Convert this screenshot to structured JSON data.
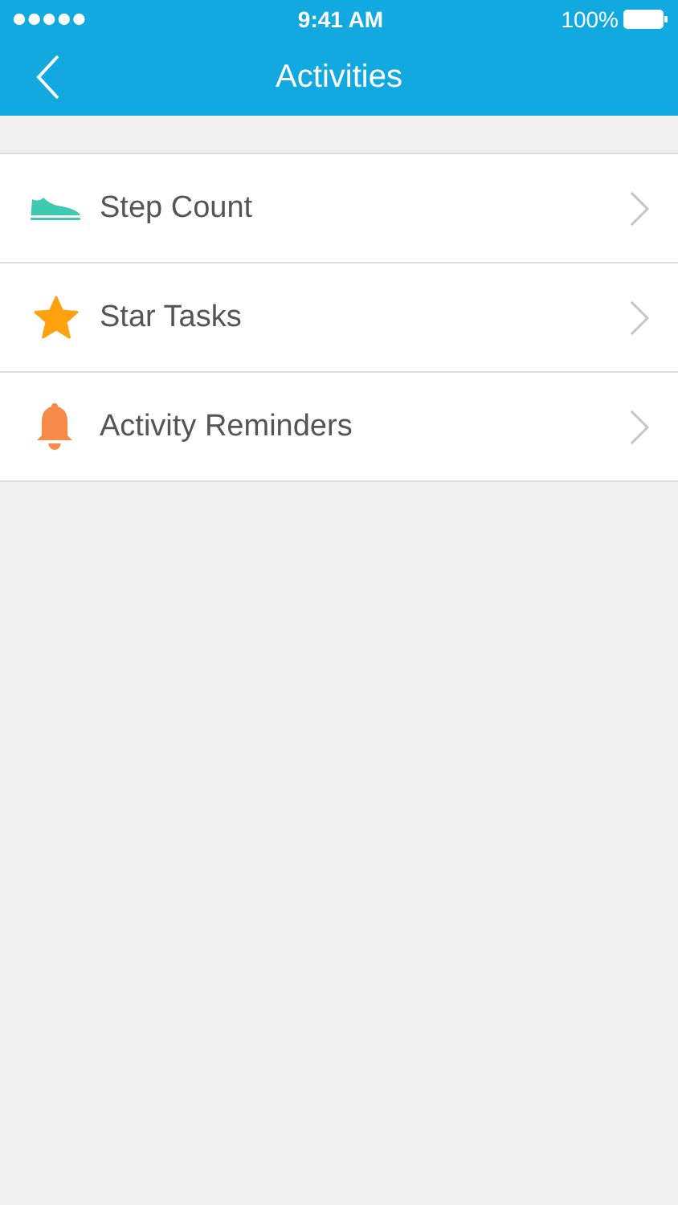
{
  "status_bar": {
    "time": "9:41 AM",
    "battery": "100%"
  },
  "nav": {
    "title": "Activities"
  },
  "items": [
    {
      "kind": "shoe",
      "label": "Step Count"
    },
    {
      "kind": "star",
      "label": "Star Tasks"
    },
    {
      "kind": "bell",
      "label": "Activity Reminders"
    }
  ]
}
